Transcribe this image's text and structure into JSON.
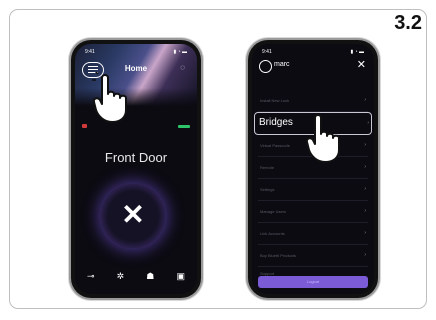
{
  "step_number": "3.2",
  "phone_left": {
    "status_time": "9:41",
    "status_icons": "▮ ◔ ▬",
    "title": "Home",
    "door_name": "Front Door",
    "nav_icons": [
      "key-icon",
      "gear-icon",
      "users-icon",
      "device-icon"
    ],
    "colors": {
      "lock_glow": "#6a4cc2",
      "battery": "#2ec46a",
      "alert": "#d03a3a"
    }
  },
  "phone_right": {
    "status_time": "9:41",
    "username": "marc",
    "menu_items": [
      {
        "label": "Install New Lock",
        "chevron": "›"
      },
      {
        "label": "Bridges",
        "chevron": "›",
        "highlighted": true
      },
      {
        "label": "Virtual Passcode",
        "chevron": "›"
      },
      {
        "label": "Remote",
        "chevron": "›"
      },
      {
        "label": "Settings",
        "chevron": "›"
      },
      {
        "label": "Manage Users",
        "chevron": "›"
      },
      {
        "label": "Link Accounts",
        "chevron": "›"
      },
      {
        "label": "Buy Bluetti Products",
        "chevron": "›"
      },
      {
        "label": "Support",
        "chevron": "›"
      }
    ],
    "logout_label": "Logout",
    "colors": {
      "logout": "#7b5bd6"
    }
  }
}
